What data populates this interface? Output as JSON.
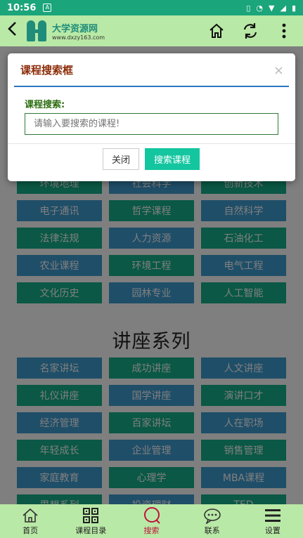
{
  "status": {
    "time": "10:56",
    "indicator": "A"
  },
  "appbar": {
    "logo_title": "大学资源网",
    "logo_url": "www.dxzy163.com",
    "icons": [
      "back-icon",
      "home-icon",
      "refresh-icon",
      "more-icon"
    ]
  },
  "top_grid": [
    {
      "label": "环境地理",
      "color": "green"
    },
    {
      "label": "社会科学",
      "color": "blue"
    },
    {
      "label": "创新技术",
      "color": "green"
    },
    {
      "label": "电子通讯",
      "color": "blue"
    },
    {
      "label": "哲学课程",
      "color": "green"
    },
    {
      "label": "自然科学",
      "color": "blue"
    },
    {
      "label": "法律法规",
      "color": "green"
    },
    {
      "label": "人力资源",
      "color": "blue"
    },
    {
      "label": "石油化工",
      "color": "green"
    },
    {
      "label": "农业课程",
      "color": "blue"
    },
    {
      "label": "环境工程",
      "color": "green"
    },
    {
      "label": "电气工程",
      "color": "blue"
    },
    {
      "label": "文化历史",
      "color": "green"
    },
    {
      "label": "园林专业",
      "color": "blue"
    },
    {
      "label": "人工智能",
      "color": "green"
    }
  ],
  "section_title": "讲座系列",
  "lecture_grid": [
    {
      "label": "名家讲坛",
      "color": "blue"
    },
    {
      "label": "成功讲座",
      "color": "green"
    },
    {
      "label": "人文讲座",
      "color": "blue"
    },
    {
      "label": "礼仪讲座",
      "color": "green"
    },
    {
      "label": "国学讲座",
      "color": "blue"
    },
    {
      "label": "演讲口才",
      "color": "green"
    },
    {
      "label": "经济管理",
      "color": "blue"
    },
    {
      "label": "百家讲坛",
      "color": "green"
    },
    {
      "label": "人在职场",
      "color": "blue"
    },
    {
      "label": "年轻成长",
      "color": "green"
    },
    {
      "label": "企业管理",
      "color": "blue"
    },
    {
      "label": "销售管理",
      "color": "green"
    },
    {
      "label": "家庭教育",
      "color": "blue"
    },
    {
      "label": "心理学",
      "color": "green"
    },
    {
      "label": "MBA课程",
      "color": "blue"
    },
    {
      "label": "思想系列",
      "color": "green"
    },
    {
      "label": "投资理财",
      "color": "blue"
    },
    {
      "label": "TED",
      "color": "green"
    }
  ],
  "colors": {
    "blue": "#3f9cd1",
    "green": "#14b08a",
    "accent": "#14c6a0",
    "nav_bg": "#b9e9a6",
    "active": "#c0123c"
  },
  "modal": {
    "title": "课程搜索框",
    "close_symbol": "×",
    "field_label": "课程搜索:",
    "input_placeholder": "请输入要搜索的课程!",
    "input_value": "",
    "cancel_label": "关闭",
    "submit_label": "搜索课程"
  },
  "bottom_nav": [
    {
      "label": "首页",
      "icon": "home-icon"
    },
    {
      "label": "课程目录",
      "icon": "qr-grid-icon"
    },
    {
      "label": "搜索",
      "icon": "search-icon",
      "active": true
    },
    {
      "label": "联系",
      "icon": "chat-icon"
    },
    {
      "label": "设置",
      "icon": "menu-icon"
    }
  ]
}
